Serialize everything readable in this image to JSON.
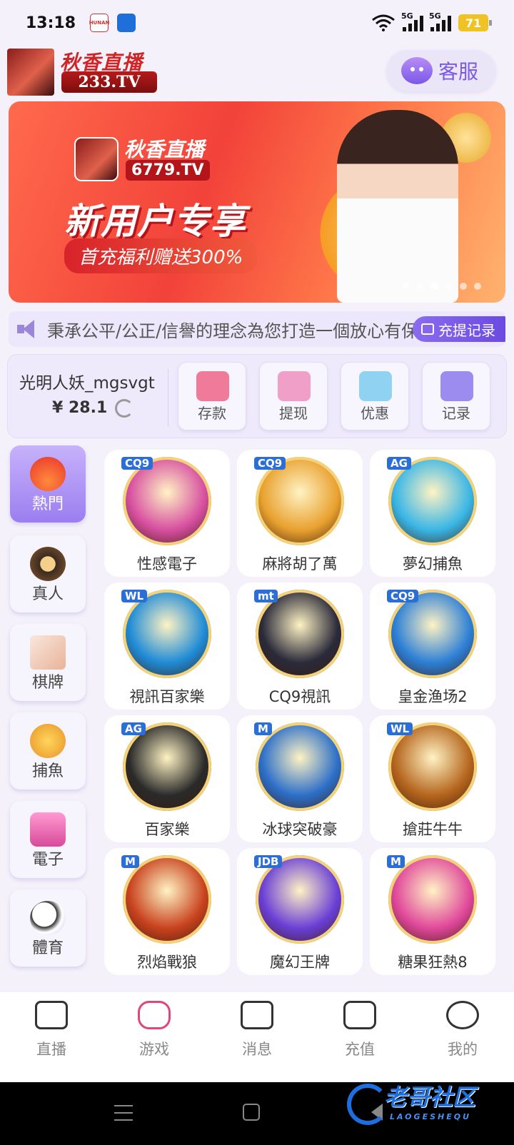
{
  "status": {
    "time": "13:18",
    "battery": "71",
    "net1": "5G",
    "net2": "5G",
    "app_tag": "HUNAN"
  },
  "header": {
    "brand_title": "秋香直播",
    "brand_url": "233.TV",
    "service_label": "客服"
  },
  "banner": {
    "brand": "秋香直播",
    "url": "6779.TV",
    "title": "新用户专享",
    "subtitle": "首充福利赠送300%",
    "slides": 6,
    "active_slide": 2
  },
  "notice": {
    "text": "秉承公平/公正/信譽的理念為您打造一個放心有保障的娛樂平台",
    "record_label": "充提记录"
  },
  "wallet": {
    "username": "光明人妖_mgsvgt",
    "balance": "¥ 28.1",
    "actions": [
      {
        "label": "存款",
        "color": "#f07a9a"
      },
      {
        "label": "提现",
        "color": "#f0a0c8"
      },
      {
        "label": "优惠",
        "color": "#8fd2f2"
      },
      {
        "label": "记录",
        "color": "#9d8cf0"
      }
    ]
  },
  "categories": [
    {
      "label": "熱門",
      "active": true
    },
    {
      "label": "真人",
      "active": false
    },
    {
      "label": "棋牌",
      "active": false
    },
    {
      "label": "捕魚",
      "active": false
    },
    {
      "label": "電子",
      "active": false
    },
    {
      "label": "體育",
      "active": false
    }
  ],
  "games": [
    {
      "name": "性感電子",
      "vendor": "CQ9"
    },
    {
      "name": "麻將胡了萬",
      "vendor": "CQ9"
    },
    {
      "name": "夢幻捕魚",
      "vendor": "AG"
    },
    {
      "name": "視訊百家樂",
      "vendor": "WL"
    },
    {
      "name": "CQ9視訊",
      "vendor": "mt"
    },
    {
      "name": "皇金渔场2",
      "vendor": "CQ9"
    },
    {
      "name": "百家樂",
      "vendor": "AG"
    },
    {
      "name": "冰球突破豪",
      "vendor": "M"
    },
    {
      "name": "搶莊牛牛",
      "vendor": "WL"
    },
    {
      "name": "烈焰戰狼",
      "vendor": "M"
    },
    {
      "name": "魔幻王牌",
      "vendor": "JDB"
    },
    {
      "name": "糖果狂熱8",
      "vendor": "M"
    }
  ],
  "tabbar": [
    {
      "label": "直播"
    },
    {
      "label": "游戏"
    },
    {
      "label": "消息"
    },
    {
      "label": "充值"
    },
    {
      "label": "我的"
    }
  ],
  "watermark": {
    "main": "老哥社区",
    "sub": "LAOGESHEQU"
  }
}
